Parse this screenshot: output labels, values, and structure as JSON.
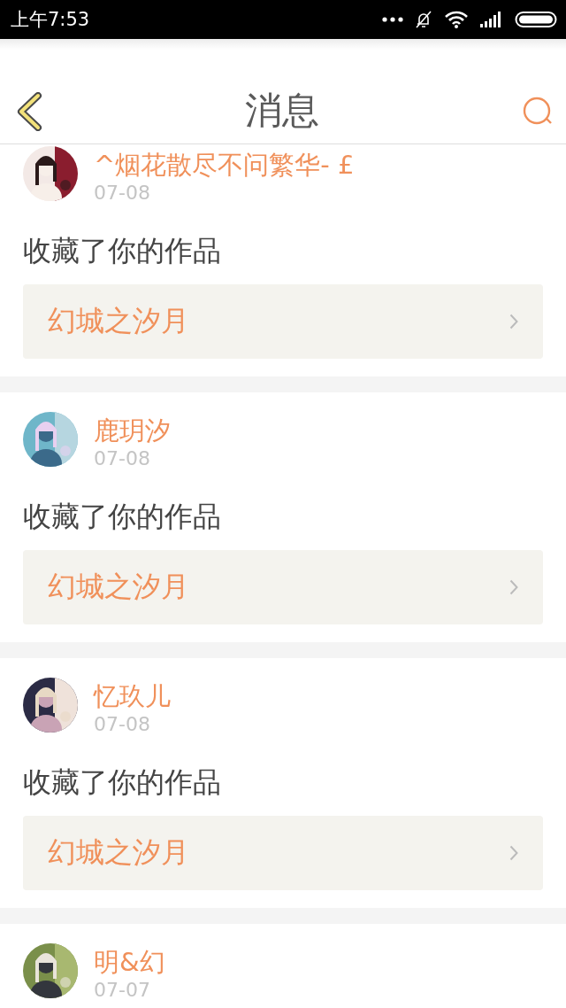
{
  "status_bar": {
    "time": "上午7:53"
  },
  "header": {
    "title": "消息"
  },
  "messages": [
    {
      "name": "^烟花散尽不问繁华- £",
      "date": "07-08",
      "action": "收藏了你的作品",
      "work": "幻城之汐月"
    },
    {
      "name": "鹿玥汐",
      "date": "07-08",
      "action": "收藏了你的作品",
      "work": "幻城之汐月"
    },
    {
      "name": "忆玖儿",
      "date": "07-08",
      "action": "收藏了你的作品",
      "work": "幻城之汐月"
    },
    {
      "name": "明&幻",
      "date": "07-07"
    }
  ]
}
